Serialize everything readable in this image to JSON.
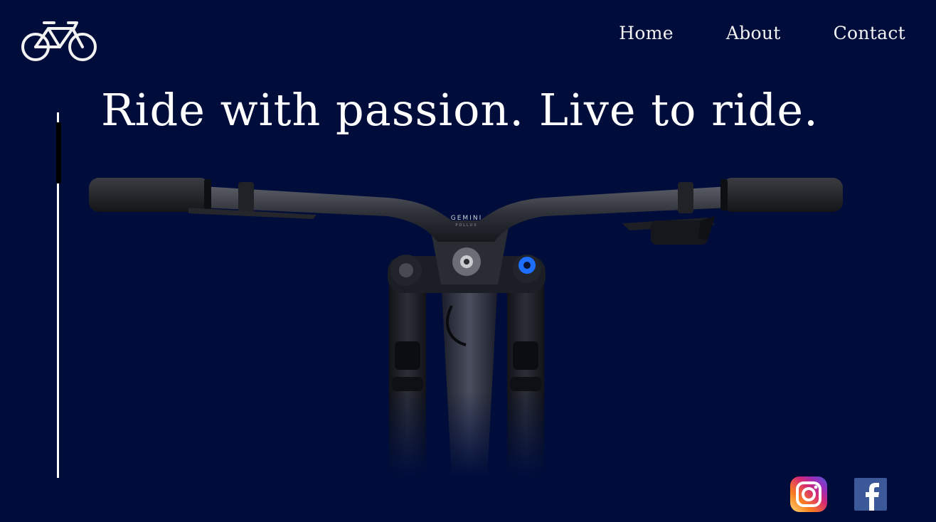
{
  "nav": {
    "items": [
      {
        "label": "Home"
      },
      {
        "label": "About"
      },
      {
        "label": "Contact"
      }
    ]
  },
  "hero": {
    "headline": "Ride with passion. Live to ride.",
    "bike_stem_text": "GEMINI",
    "bike_stem_subtext": "POLLUX"
  },
  "icons": {
    "logo": "bicycle-icon",
    "social": [
      "instagram-icon",
      "facebook-icon"
    ]
  },
  "colors": {
    "background": "#000d3b",
    "text": "#ffffff",
    "facebook": "#3b5998",
    "instagram_gradient": [
      "#feda75",
      "#fa7e1e",
      "#d62976",
      "#962fbf",
      "#4f5bd5"
    ],
    "fork_accent": "#1e6fff"
  }
}
